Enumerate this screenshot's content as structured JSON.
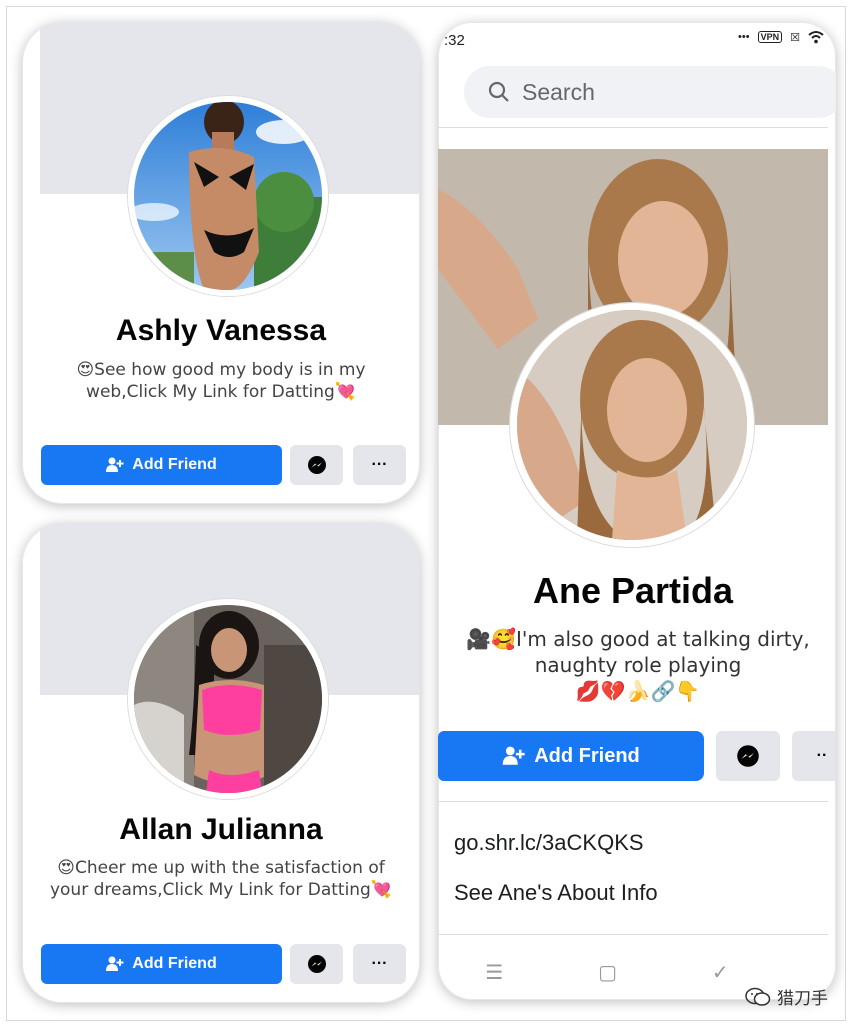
{
  "cards": [
    {
      "name": "Ashly Vanessa",
      "bio_line1": "😍See how good my body is in my",
      "bio_line2": "web,Click My Link for Datting💘",
      "add_friend_label": "Add Friend",
      "more_label": "···"
    },
    {
      "name": "Allan Julianna",
      "bio_line1": "😍Cheer me up with the satisfaction of",
      "bio_line2": "your dreams,Click My Link for Datting💘",
      "add_friend_label": "Add Friend",
      "more_label": "···"
    }
  ],
  "phone": {
    "status_time": ":32",
    "status_vpn": "VPN",
    "search_placeholder": "Search",
    "name": "Ane Partida",
    "bio_line1": "🎥🥰I'm also good at talking dirty,",
    "bio_line2": "naughty role playing",
    "bio_line3": "💋💔🍌🔗👇",
    "add_friend_label": "Add Friend",
    "more_label": "··",
    "link": "go.shr.lc/3aCKQKS",
    "about": "See Ane's About Info",
    "nav": [
      "☰",
      "▢",
      "✓"
    ]
  },
  "watermark": "猎刀手",
  "colors": {
    "primary": "#1877f2",
    "secondary_btn": "#e4e6eb",
    "cover": "#e4e6eb"
  }
}
